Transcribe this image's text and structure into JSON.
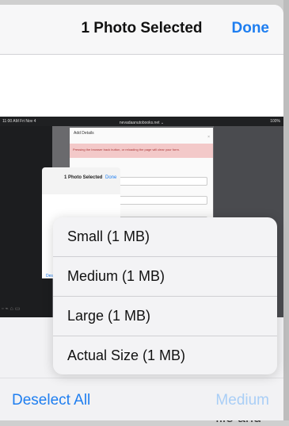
{
  "header": {
    "title": "1 Photo Selected",
    "done_label": "Done"
  },
  "thumbnail": {
    "status_time": "11:00 AM  Fri Nov 4",
    "status_url": "nevadaanutobooks.net ⌄",
    "status_battery": "100%",
    "dialog_title": "Add Details",
    "dialog_warning": "Pressing the browser back button, or reloading the page will clear your form.",
    "mini_title": "1 Photo Selected",
    "mini_done": "Done",
    "mini_deselect": "Des"
  },
  "size_menu": {
    "items": [
      {
        "label": "Small (1 MB)"
      },
      {
        "label": "Medium (1 MB)"
      },
      {
        "label": "Large (1 MB)"
      },
      {
        "label": "Actual Size (1 MB)"
      }
    ]
  },
  "footer": {
    "deselect_label": "Deselect All",
    "size_label": "Medium"
  },
  "background": {
    "partial_text": "file and"
  },
  "colors": {
    "accent": "#1e7ef0",
    "accent_disabled": "#a9cef6"
  }
}
